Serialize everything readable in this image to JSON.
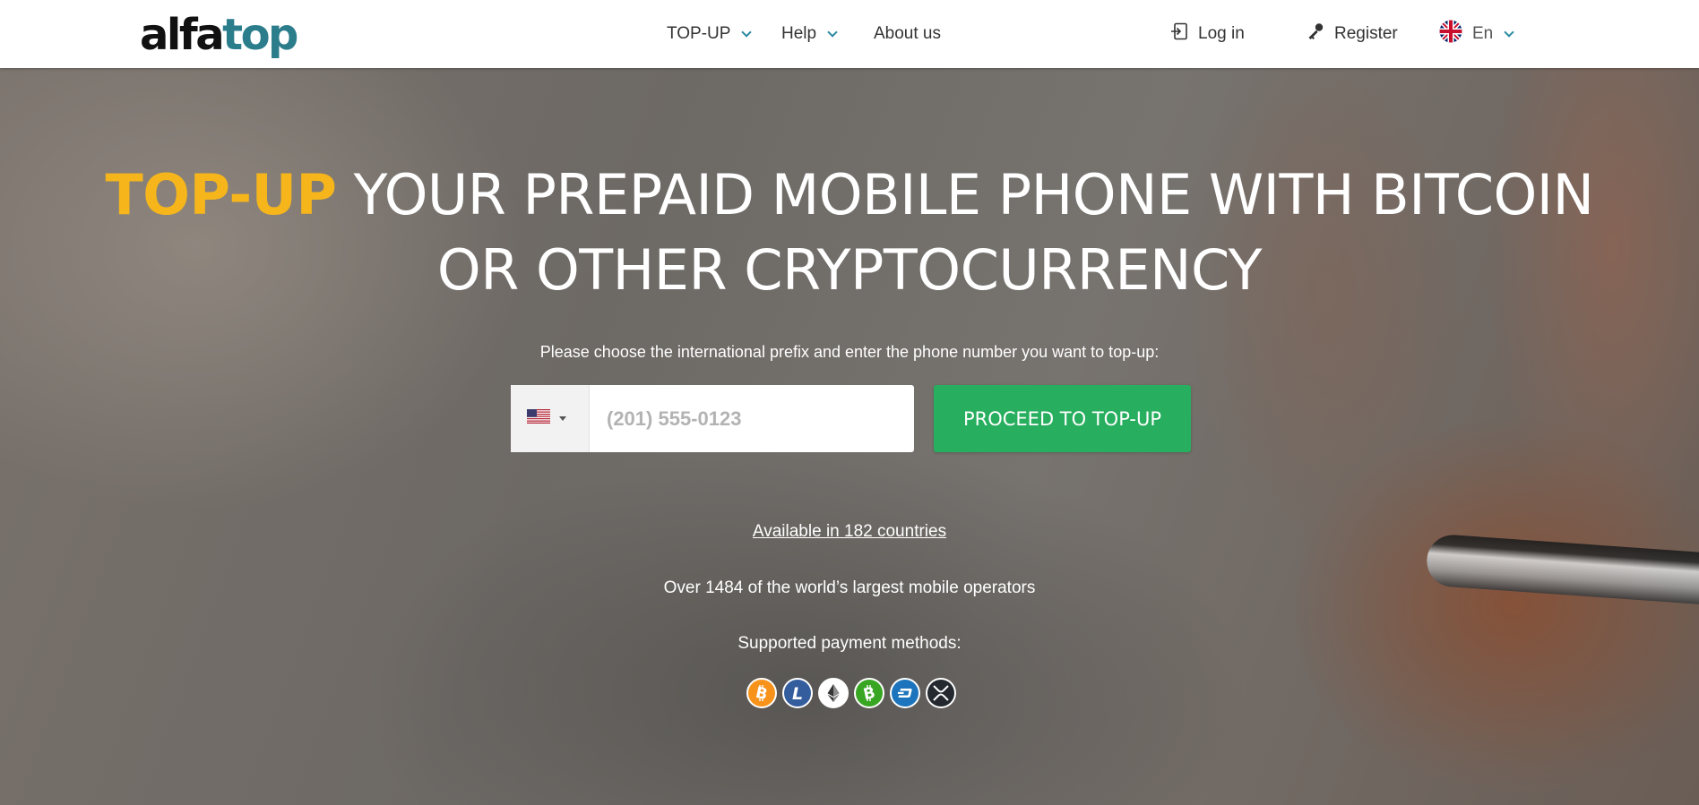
{
  "header": {
    "logo_part1": "alfa",
    "logo_part2": "top",
    "nav": [
      {
        "label": "TOP-UP"
      },
      {
        "label": "Help"
      },
      {
        "label": "About us"
      }
    ],
    "login_label": "Log in",
    "register_label": "Register",
    "language_label": "En"
  },
  "hero": {
    "title_accent": "TOP-UP",
    "title_line1_rest": " YOUR PREPAID MOBILE PHONE WITH BITCOIN",
    "title_line2": "OR OTHER CRYPTOCURRENCY",
    "instruction": "Please choose the international prefix and enter the phone number you want to top-up:",
    "phone_placeholder": "(201) 555-0123",
    "proceed_label": "PROCEED TO TOP-UP",
    "countries_link": "Available in 182 countries",
    "operators_text": "Over 1484 of the world’s largest mobile operators",
    "payments_label": "Supported payment methods:"
  },
  "payment_methods": [
    {
      "icon": "bitcoin-icon",
      "color": "#f7931a"
    },
    {
      "icon": "litecoin-icon",
      "color": "#345d9d"
    },
    {
      "icon": "ethereum-icon",
      "color": "#ffffff"
    },
    {
      "icon": "bitcoin-cash-icon",
      "color": "#38a523"
    },
    {
      "icon": "dash-icon",
      "color": "#1c75bc"
    },
    {
      "icon": "ripple-icon",
      "color": "#23292f"
    }
  ],
  "colors": {
    "accent_yellow": "#f6b61b",
    "proceed_green": "#27ae5e",
    "logo_teal": "#2c7d8c"
  }
}
